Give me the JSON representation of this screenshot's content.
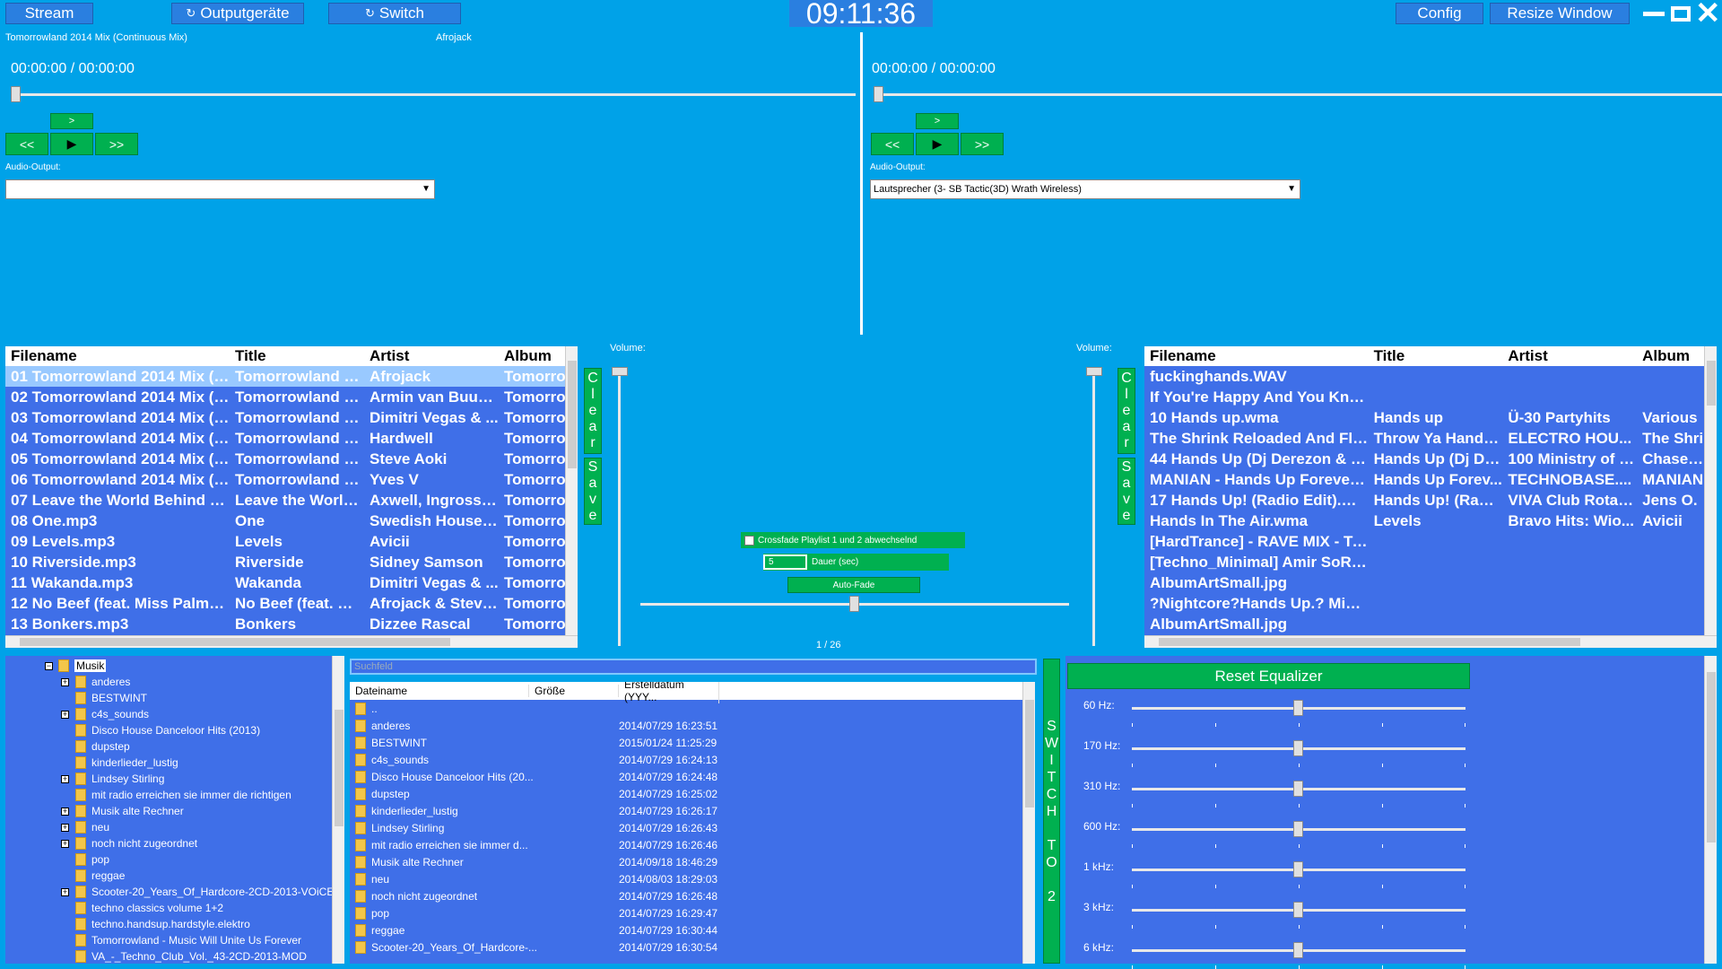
{
  "toolbar": {
    "stream_label": "Stream",
    "output_label": "Outputgeräte",
    "switch_label": "Switch",
    "clock": "09:11:36",
    "config_label": "Config",
    "resize_label": "Resize Window"
  },
  "deck1": {
    "title": "Tomorrowland 2014 Mix (Continuous Mix)",
    "artist": "Afrojack",
    "time": "00:00:00 / 00:00:00",
    "up_label": ">",
    "prev_label": "<<",
    "play_label": "▶",
    "next_label": ">>",
    "audio_output_label": "Audio-Output:",
    "audio_output_value": ""
  },
  "deck2": {
    "time": "00:00:00 / 00:00:00",
    "up_label": ">",
    "prev_label": "<<",
    "play_label": "▶",
    "next_label": ">>",
    "audio_output_label": "Audio-Output:",
    "audio_output_value": "Lautsprecher (3- SB Tactic(3D) Wrath Wireless)"
  },
  "center": {
    "volume_label_left": "Volume:",
    "volume_label_right": "Volume:",
    "clear_label": "Clear",
    "save_label": "Save",
    "crossfade_label": "Crossfade Playlist 1 und 2 abwechselnd",
    "duration_value": "5",
    "duration_label": "Dauer (sec)",
    "autofade_label": "Auto-Fade",
    "page_indicator": "1 / 26"
  },
  "playlist1": {
    "columns": [
      "Filename",
      "Title",
      "Artist",
      "Album"
    ],
    "rows": [
      [
        "01 Tomorrowland 2014 Mix (C...",
        "Tomorrowland 2...",
        "Afrojack",
        "Tomorro"
      ],
      [
        "02 Tomorrowland 2014 Mix (C...",
        "Tomorrowland 2...",
        "Armin van Buuren",
        "Tomorro"
      ],
      [
        "03 Tomorrowland 2014 Mix (C...",
        "Tomorrowland 2...",
        "Dimitri Vegas & ...",
        "Tomorro"
      ],
      [
        "04 Tomorrowland 2014 Mix (C...",
        "Tomorrowland 2...",
        "Hardwell",
        "Tomorro"
      ],
      [
        "05 Tomorrowland 2014 Mix (C...",
        "Tomorrowland 2...",
        "Steve Aoki",
        "Tomorro"
      ],
      [
        "06 Tomorrowland 2014 Mix (C...",
        "Tomorrowland 2...",
        "Yves V",
        "Tomorro"
      ],
      [
        "07 Leave the World Behind (f...",
        "Leave the World...",
        "Axwell, Ingrosso...",
        "Tomorro"
      ],
      [
        "08 One.mp3",
        "One",
        "Swedish House ...",
        "Tomorro"
      ],
      [
        "09 Levels.mp3",
        "Levels",
        "Avicii",
        "Tomorro"
      ],
      [
        "10 Riverside.mp3",
        "Riverside",
        "Sidney Samson",
        "Tomorro"
      ],
      [
        "11 Wakanda.mp3",
        "Wakanda",
        "Dimitri Vegas & ...",
        "Tomorro"
      ],
      [
        "12 No Beef (feat. Miss Palmer)...",
        "No Beef (feat. Mi...",
        "Afrojack & Steve...",
        "Tomorro"
      ],
      [
        "13 Bonkers.mp3",
        "Bonkers",
        "Dizzee Rascal",
        "Tomorro"
      ]
    ]
  },
  "playlist2": {
    "columns": [
      "Filename",
      "Title",
      "Artist",
      "Album"
    ],
    "rows": [
      [
        "fuckinghands.WAV",
        "",
        "",
        ""
      ],
      [
        "If You're Happy And You Kno...",
        "",
        "",
        ""
      ],
      [
        "10 Hands up.wma",
        "Hands up",
        "Ü-30 Partyhits",
        "Various"
      ],
      [
        "The Shrink Reloaded And Flip...",
        "Throw Ya Hands...",
        "ELECTRO HOU...",
        "The Shri"
      ],
      [
        "44 Hands Up (Dj Derezon & N...",
        "Hands Up (Dj De...",
        "100 Ministry of S...",
        "Chase M"
      ],
      [
        "MANIAN - Hands Up Forever....",
        "Hands Up Forev...",
        "TECHNOBASE....",
        "MANIAN"
      ],
      [
        "17 Hands Up! (Radio Edit).m4a",
        "Hands Up! (Radi...",
        "VIVA Club Rotati...",
        "Jens O."
      ],
      [
        "Hands In The Air.wma",
        "Levels",
        "Bravo Hits: Wio...",
        "Avicii"
      ],
      [
        "[HardTrance] - RAVE MIX - Tra...",
        "",
        "",
        ""
      ],
      [
        "[Techno_Minimal] Amir SoRa ...",
        "",
        "",
        ""
      ],
      [
        "AlbumArtSmall.jpg",
        "",
        "",
        ""
      ],
      [
        "?Nightcore?Hands Up.? Mix ...",
        "",
        "",
        ""
      ],
      [
        "AlbumArtSmall.jpg",
        "",
        "",
        ""
      ]
    ]
  },
  "tree": {
    "root": "Musik",
    "items": [
      "anderes",
      "BESTWINT",
      "c4s_sounds",
      "Disco House Danceloor Hits (2013)",
      "dupstep",
      "kinderlieder_lustig",
      "Lindsey Stirling",
      "mit radio erreichen sie immer die richtigen",
      "Musik alte Rechner",
      "neu",
      "noch nicht zugeordnet",
      "pop",
      "reggae",
      "Scooter-20_Years_Of_Hardcore-2CD-2013-VOiCE",
      "techno classics volume 1+2",
      "techno.handsup.hardstyle.elektro",
      "Tomorrowland - Music Will Unite Us Forever",
      "VA_-_Techno_Club_Vol._43-2CD-2013-MOD"
    ]
  },
  "filebrowser": {
    "search_placeholder": "Suchfeld",
    "columns": [
      "Dateiname",
      "Größe",
      "Erstelldatum (YYY..."
    ],
    "rows": [
      [
        "..",
        ""
      ],
      [
        "anderes",
        "2014/07/29 16:23:51"
      ],
      [
        "BESTWINT",
        "2015/01/24 11:25:29"
      ],
      [
        "c4s_sounds",
        "2014/07/29 16:24:13"
      ],
      [
        "Disco House Danceloor Hits (20...",
        "2014/07/29 16:24:48"
      ],
      [
        "dupstep",
        "2014/07/29 16:25:02"
      ],
      [
        "kinderlieder_lustig",
        "2014/07/29 16:26:17"
      ],
      [
        "Lindsey Stirling",
        "2014/07/29 16:26:43"
      ],
      [
        "mit radio erreichen sie immer d...",
        "2014/07/29 16:26:46"
      ],
      [
        "Musik alte Rechner",
        "2014/09/18 18:46:29"
      ],
      [
        "neu",
        "2014/08/03 18:29:03"
      ],
      [
        "noch nicht zugeordnet",
        "2014/07/29 16:26:48"
      ],
      [
        "pop",
        "2014/07/29 16:29:47"
      ],
      [
        "reggae",
        "2014/07/29 16:30:44"
      ],
      [
        "Scooter-20_Years_Of_Hardcore-...",
        "2014/07/29 16:30:54"
      ]
    ],
    "switch_text": [
      "S",
      "W",
      "I",
      "T",
      "C",
      "H",
      "",
      "T",
      "O",
      "",
      "2"
    ]
  },
  "equalizer": {
    "reset_label": "Reset Equalizer",
    "bands": [
      "60 Hz:",
      "170 Hz:",
      "310 Hz:",
      "600 Hz:",
      "1 kHz:",
      "3 kHz:",
      "6 kHz:"
    ]
  }
}
